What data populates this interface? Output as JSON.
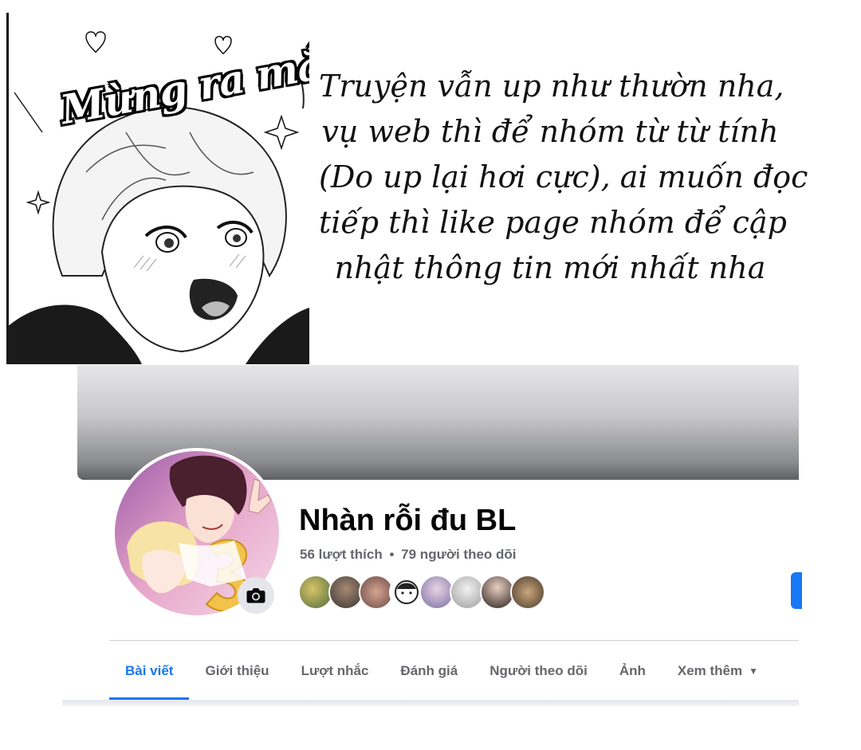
{
  "manga": {
    "caption": "Mừng ra mắt"
  },
  "note": {
    "lines": [
      "Truyện vẫn up như thườn nha,",
      "vụ web thì để nhóm từ từ tính",
      "(Do up lại hơi cực), ai muốn đọc",
      "tiếp thì like page nhóm để cập",
      "nhật thông tin mới nhất nha"
    ]
  },
  "page": {
    "name": "Nhàn rỗi đu BL",
    "likes": "56 lượt thích",
    "separator": "•",
    "followers": "79 người theo dõi"
  },
  "icons": {
    "camera": "camera-icon",
    "caret": "caret-down-icon"
  },
  "tabs": [
    {
      "label": "Bài viết",
      "active": true
    },
    {
      "label": "Giới thiệu"
    },
    {
      "label": "Lượt nhắc"
    },
    {
      "label": "Đánh giá"
    },
    {
      "label": "Người theo dõi"
    },
    {
      "label": "Ảnh"
    },
    {
      "label": "Xem thêm"
    }
  ],
  "colors": {
    "accent": "#1877f2",
    "secondary_text": "#65676b",
    "primary_text": "#050505"
  }
}
